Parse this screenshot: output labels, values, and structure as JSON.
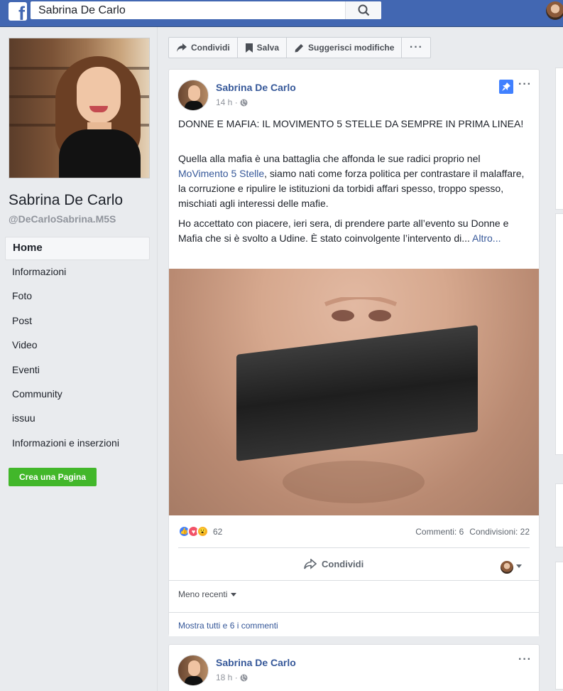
{
  "topbar": {
    "logo": "f",
    "search_value": "Sabrina De Carlo",
    "icons": [
      "facebook-logo",
      "search-icon",
      "avatar"
    ]
  },
  "sidebar": {
    "page_name": "Sabrina De Carlo",
    "page_handle": "@DeCarloSabrina.M5S",
    "items": [
      {
        "label": "Home",
        "active": true
      },
      {
        "label": "Informazioni"
      },
      {
        "label": "Foto"
      },
      {
        "label": "Post"
      },
      {
        "label": "Video"
      },
      {
        "label": "Eventi"
      },
      {
        "label": "Community"
      },
      {
        "label": "issuu"
      },
      {
        "label": "Informazioni e inserzioni"
      }
    ],
    "create_page_label": "Crea una Pagina"
  },
  "action_bar": {
    "share_label": "Condividi",
    "save_label": "Salva",
    "suggest_label": "Suggerisci modifiche",
    "more_label": "···"
  },
  "post1": {
    "author": "Sabrina De Carlo",
    "time": "14 h ·",
    "more": "···",
    "headline": "DONNE E MAFIA: IL MOVIMENTO 5 STELLE DA SEMPRE IN PRIMA LINEA!",
    "para1_before": "Quella alla mafia è una battaglia che affonda le sue radici proprio nel ",
    "para1_link": "MoVimento 5 Stelle",
    "para1_after": ", siamo nati come forza politica per contrastare il malaffare, la corruzione e ripulire le istituzioni da torbidi affari spesso, troppo spesso, mischiati agli interessi delle mafie.",
    "para2": "Ho accettato con piacere, ieri sera, di prendere parte all’evento su Donne e Mafia che si è svolto a Udine. È stato coinvolgente l’intervento di... ",
    "more_link": "Altro...",
    "reaction_count": "62",
    "comments": "Commenti: 6",
    "shares": "Condivisioni: 22",
    "share_button": "Condividi",
    "sort_label": "Meno recenti",
    "show_all": "Mostra tutti e 6 i commenti",
    "colors": {
      "like": "#4080ff",
      "love": "#f25268",
      "wow": "#f7b125",
      "link": "#365899"
    }
  },
  "post2": {
    "author": "Sabrina De Carlo",
    "time": "18 h ·",
    "more": "···"
  }
}
